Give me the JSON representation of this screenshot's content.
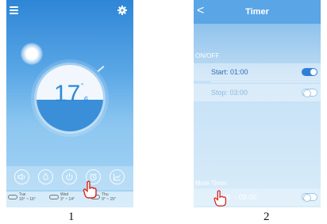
{
  "captions": {
    "first": "1",
    "second": "2"
  },
  "screen1": {
    "temperature": {
      "integer": "17",
      "decimal": ".6",
      "degree": "°"
    },
    "buttons": [
      {
        "name": "volume-button",
        "icon": "speaker-icon"
      },
      {
        "name": "drop-button",
        "icon": "water-drop-icon"
      },
      {
        "name": "power-button",
        "icon": "power-icon"
      },
      {
        "name": "timer-button",
        "icon": "alarm-clock-icon"
      },
      {
        "name": "chart-button",
        "icon": "trend-chart-icon"
      }
    ],
    "weather": [
      {
        "day": "Tue",
        "range": "10° ~ 16°"
      },
      {
        "day": "Wed",
        "range": "3° ~ 14°"
      },
      {
        "day": "Thu",
        "range": "9° ~ 15°"
      }
    ]
  },
  "screen2": {
    "title": "Timer",
    "back_icon": "<",
    "onoff_label": "ON/OFF",
    "start": "Start: 01:00",
    "stop": "Stop: 03:00",
    "mute_label": "Mute Timer",
    "mute_range": "14:00 ~ 09:00",
    "start_on": true,
    "stop_on": false,
    "mute_on": false
  },
  "colors": {
    "accent": "#2f88d6",
    "toggle_on": "#2f7fd6"
  }
}
